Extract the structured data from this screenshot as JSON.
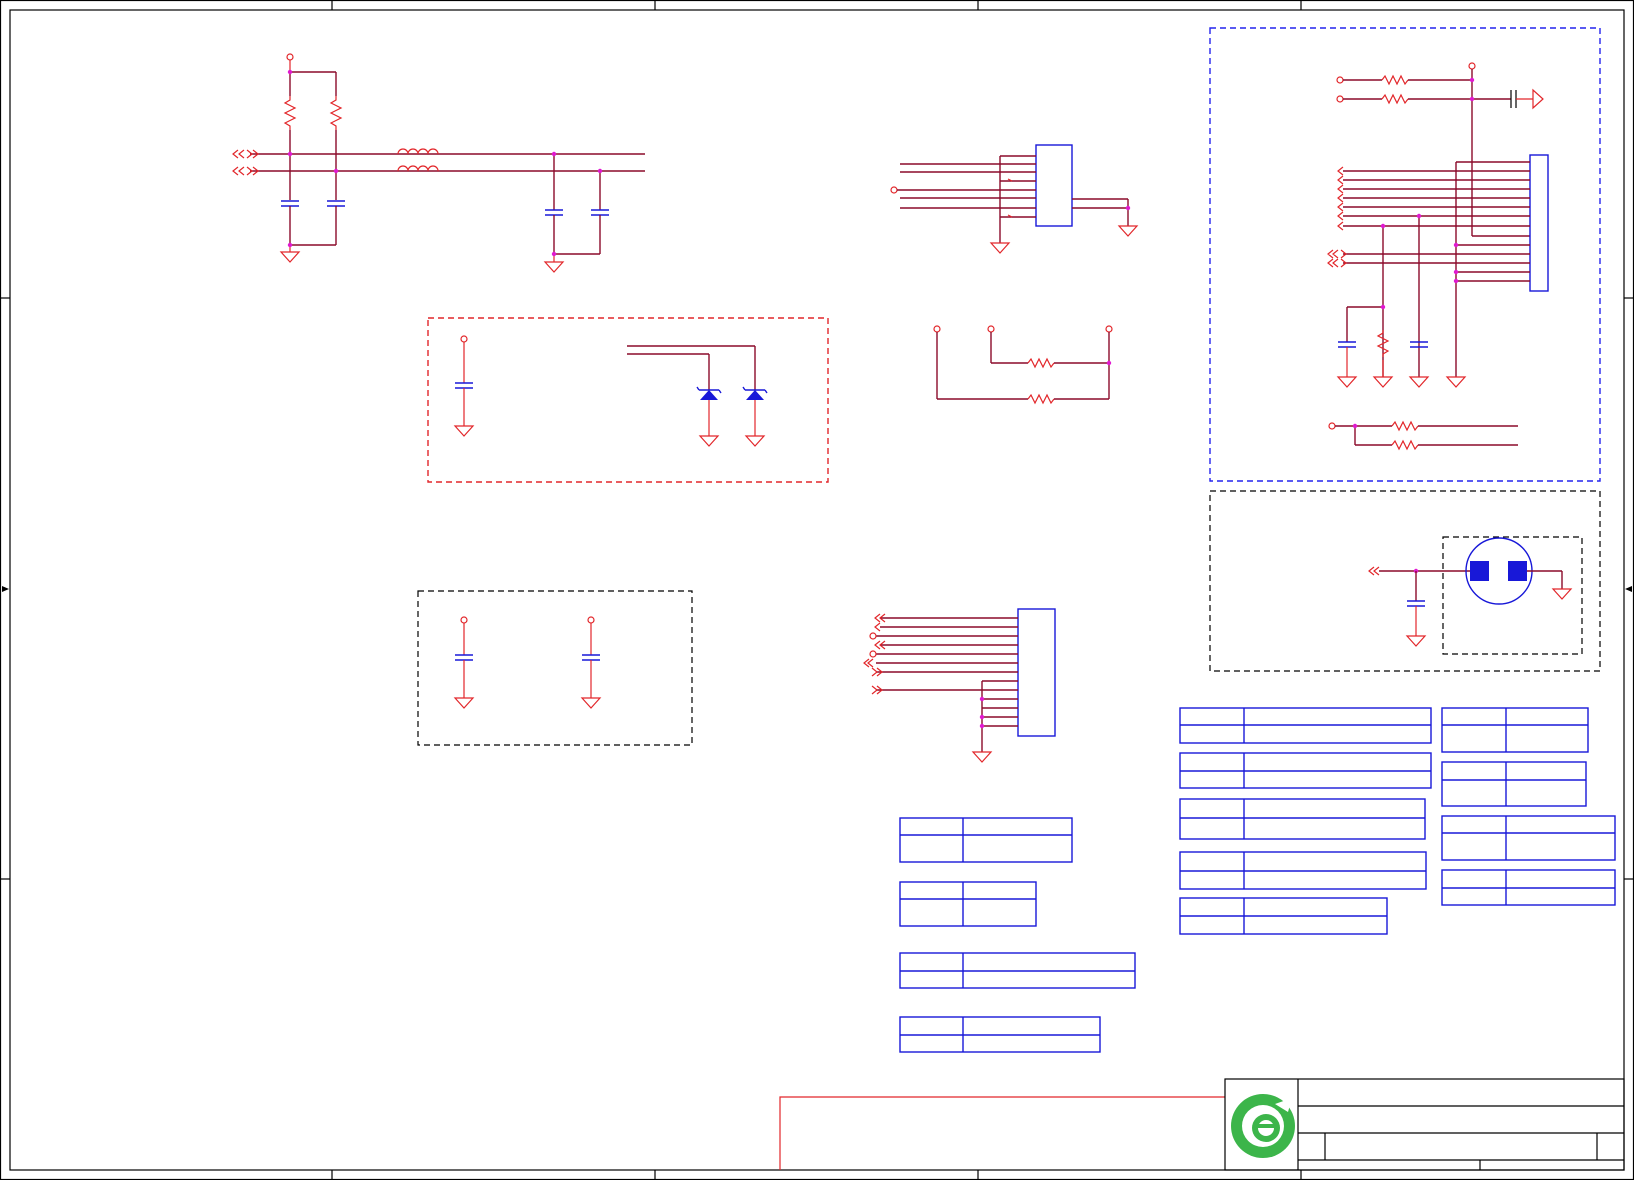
{
  "sheet": {
    "colors": {
      "wire": "#8b0a2a",
      "component": "#e2262a",
      "part_outline": "#1818d8",
      "junction": "#e01ad0",
      "border": "#000000",
      "logo_green": "#3cb54a"
    },
    "logo": {
      "icon": "logo-e-icon"
    }
  }
}
